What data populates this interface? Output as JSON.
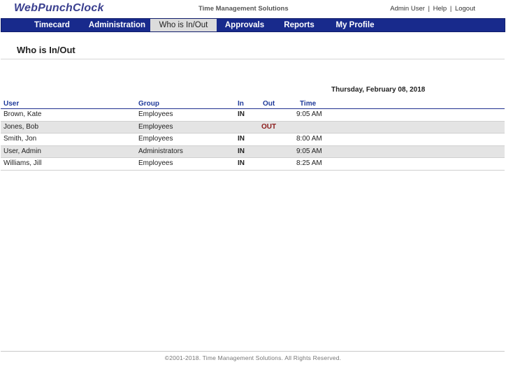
{
  "header": {
    "logo_text": "WebPunchClock",
    "company": "Time Management Solutions",
    "user_links": [
      {
        "label": "Admin User"
      },
      {
        "label": "Help"
      },
      {
        "label": "Logout"
      }
    ],
    "separator": "|"
  },
  "nav": {
    "items": [
      {
        "label": "Timecard",
        "active": false
      },
      {
        "label": "Administration",
        "active": false
      },
      {
        "label": "Who is In/Out",
        "active": true
      },
      {
        "label": "Approvals",
        "active": false
      },
      {
        "label": "Reports",
        "active": false
      },
      {
        "label": "My Profile",
        "active": false
      }
    ]
  },
  "page": {
    "title": "Who is In/Out",
    "date": "Thursday, February 08, 2018"
  },
  "table": {
    "columns": {
      "user": "User",
      "group": "Group",
      "in": "In",
      "out": "Out",
      "time": "Time"
    },
    "rows": [
      {
        "user": "Brown, Kate",
        "group": "Employees",
        "in": "IN",
        "out": "",
        "time": "9:05 AM"
      },
      {
        "user": "Jones, Bob",
        "group": "Employees",
        "in": "",
        "out": "OUT",
        "time": ""
      },
      {
        "user": "Smith, Jon",
        "group": "Employees",
        "in": "IN",
        "out": "",
        "time": "8:00 AM"
      },
      {
        "user": "User, Admin",
        "group": "Administrators",
        "in": "IN",
        "out": "",
        "time": "9:05 AM"
      },
      {
        "user": "Williams, Jill",
        "group": "Employees",
        "in": "IN",
        "out": "",
        "time": "8:25 AM"
      }
    ]
  },
  "footer": {
    "text": "©2001-2018. Time Management Solutions. All Rights Reserved."
  },
  "colors": {
    "nav_background": "#182a8c",
    "logo": "#3a3f8f",
    "column_header": "#1f3a9a",
    "out_status": "#8b1a1a",
    "alt_row": "#e4e4e4"
  }
}
